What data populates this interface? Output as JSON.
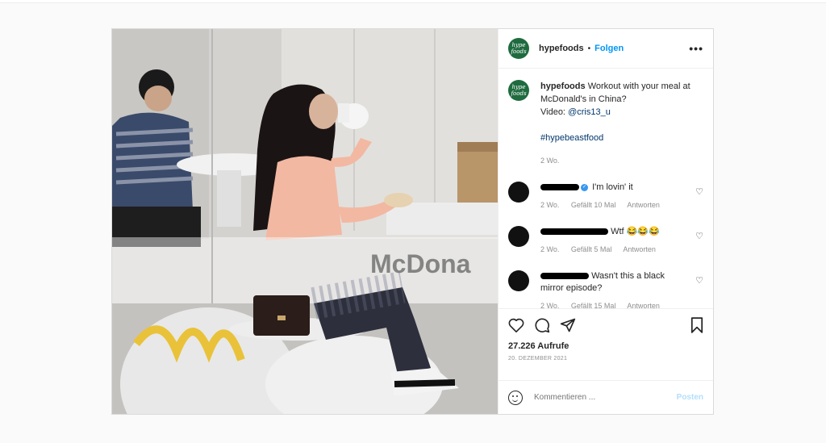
{
  "account": {
    "username": "hypefoods",
    "avatar_text": "hype foods",
    "follow_label": "Folgen",
    "separator": "•"
  },
  "caption": {
    "username": "hypefoods",
    "text": "Workout with your meal at McDonald's in China?",
    "video_label": "Video:",
    "video_handle": "@cris13_u",
    "hashtag": "#hypebeastfood",
    "time": "2 Wo."
  },
  "comments": [
    {
      "text": "I'm lovin' it",
      "time": "2 Wo.",
      "likes": "Gefällt 10 Mal",
      "reply": "Antworten",
      "verified": true
    },
    {
      "text": "Wtf 😂😂😂",
      "time": "2 Wo.",
      "likes": "Gefällt 5 Mal",
      "reply": "Antworten",
      "verified": false
    },
    {
      "text": "Wasn't this a black mirror episode?",
      "time": "2 Wo.",
      "likes": "Gefällt 15 Mal",
      "reply": "Antworten",
      "verified": false
    }
  ],
  "stats": {
    "views": "27.226 Aufrufe",
    "date": "20. DEZEMBER 2021"
  },
  "composer": {
    "placeholder": "Kommentieren ...",
    "post_label": "Posten"
  },
  "icons": [
    "more-icon",
    "heart-icon",
    "comment-icon",
    "share-icon",
    "bookmark-icon",
    "emoji-icon"
  ],
  "media": {
    "glass_lettering": "McDona"
  },
  "colors": {
    "accent": "#0095f6",
    "brand_green": "#1f6b3f",
    "muted": "#8e8e8e",
    "link": "#00376b"
  }
}
